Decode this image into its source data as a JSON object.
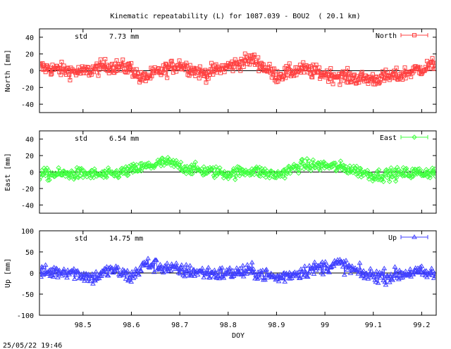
{
  "title": "Kinematic repeatability (L) for 1087.039 - BOU2  ( 20.1 km)",
  "footer_timestamp": "25/05/22 19:46",
  "chart_data": [
    {
      "type": "scatter",
      "series": [
        {
          "name": "North",
          "color": "#ff4040",
          "marker": "square"
        }
      ],
      "ylabel": "North [mm]",
      "std_label": "std",
      "std_value": "7.73 mm",
      "ylim": [
        -50,
        50
      ],
      "yticks": [
        -40,
        -20,
        0,
        20,
        40
      ],
      "xlim": [
        98.41,
        99.23
      ],
      "profile": {
        "mean": 0,
        "amplitude": 7.73,
        "bumps": [
          [
            98.41,
            4
          ],
          [
            98.5,
            -2
          ],
          [
            98.55,
            6
          ],
          [
            98.6,
            3
          ],
          [
            98.62,
            -10
          ],
          [
            98.7,
            8
          ],
          [
            98.75,
            -4
          ],
          [
            98.8,
            5
          ],
          [
            98.85,
            14
          ],
          [
            98.9,
            -6
          ],
          [
            98.95,
            2
          ],
          [
            99.0,
            -4
          ],
          [
            99.05,
            -8
          ],
          [
            99.1,
            -10
          ],
          [
            99.15,
            -6
          ],
          [
            99.23,
            8
          ]
        ]
      }
    },
    {
      "type": "scatter",
      "series": [
        {
          "name": "East",
          "color": "#40ff40",
          "marker": "diamond"
        }
      ],
      "ylabel": "East [mm]",
      "std_label": "std",
      "std_value": "6.54 mm",
      "ylim": [
        -50,
        50
      ],
      "yticks": [
        -40,
        -20,
        0,
        20,
        40
      ],
      "xlim": [
        98.41,
        99.23
      ],
      "profile": {
        "mean": 0,
        "amplitude": 6.54,
        "bumps": [
          [
            98.41,
            -3
          ],
          [
            98.5,
            -2
          ],
          [
            98.55,
            -4
          ],
          [
            98.6,
            2
          ],
          [
            98.67,
            12
          ],
          [
            98.72,
            4
          ],
          [
            98.8,
            -2
          ],
          [
            98.85,
            2
          ],
          [
            98.9,
            -4
          ],
          [
            98.95,
            8
          ],
          [
            99.0,
            8
          ],
          [
            99.05,
            4
          ],
          [
            99.1,
            -4
          ],
          [
            99.15,
            -2
          ],
          [
            99.23,
            0
          ]
        ]
      }
    },
    {
      "type": "scatter",
      "series": [
        {
          "name": "Up",
          "color": "#4040ff",
          "marker": "triangle"
        }
      ],
      "ylabel": "Up [mm]",
      "std_label": "std",
      "std_value": "14.75 mm",
      "ylim": [
        -100,
        100
      ],
      "yticks": [
        -100,
        -50,
        0,
        50,
        100
      ],
      "xlim": [
        98.41,
        99.23
      ],
      "profile": {
        "mean": 0,
        "amplitude": 14.75,
        "bumps": [
          [
            98.41,
            0
          ],
          [
            98.47,
            5
          ],
          [
            98.52,
            -12
          ],
          [
            98.56,
            8
          ],
          [
            98.6,
            -10
          ],
          [
            98.63,
            22
          ],
          [
            98.7,
            6
          ],
          [
            98.78,
            -2
          ],
          [
            98.85,
            4
          ],
          [
            98.9,
            -12
          ],
          [
            98.97,
            8
          ],
          [
            99.03,
            22
          ],
          [
            99.08,
            -4
          ],
          [
            99.13,
            -8
          ],
          [
            99.18,
            2
          ],
          [
            99.23,
            -4
          ]
        ]
      }
    }
  ],
  "xaxis": {
    "label": "DOY",
    "ticks": [
      98.5,
      98.6,
      98.7,
      98.8,
      98.9,
      99,
      99.1,
      99.2
    ],
    "tick_labels": [
      "98.5",
      "98.6",
      "98.7",
      "98.8",
      "98.9",
      "99",
      "99.1",
      "99.2"
    ]
  }
}
